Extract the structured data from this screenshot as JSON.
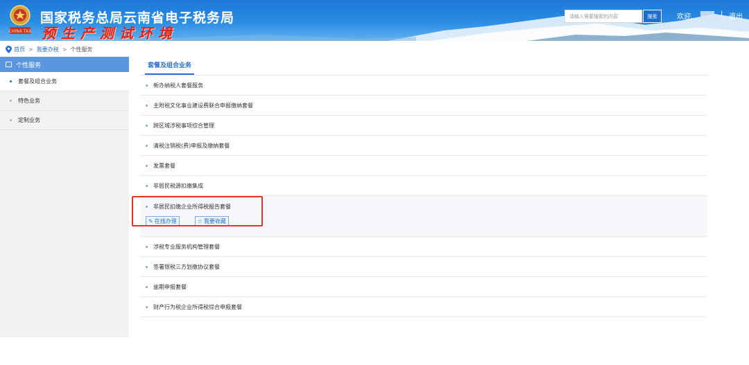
{
  "header": {
    "site_title": "国家税务总局云南省电子税务局",
    "env_banner": "预生产测试环境",
    "search_placeholder": "请输入需要搜索的内容",
    "search_button": "搜索",
    "welcome": "欢迎,",
    "separator": "|",
    "logout": "退出",
    "emblem_text": "CHINA TAX"
  },
  "breadcrumb": {
    "home": "首页",
    "level2": "我要办税",
    "current": "个性服务",
    "sep": ">"
  },
  "sidebar": {
    "title": "个性服务",
    "items": [
      {
        "label": "套餐及组合业务",
        "active": true
      },
      {
        "label": "特色业务",
        "active": false
      },
      {
        "label": "定制业务",
        "active": false
      }
    ]
  },
  "main": {
    "tab_label": "套餐及组合业务",
    "rows": [
      "新办纳税人套餐服务",
      "主附税文化事业建设费联合申报缴纳套餐",
      "跨区域涉税事项综合管理",
      "清税注销税(费)申报及缴纳套餐",
      "发票套餐",
      "非居民税源扣缴集成",
      "非居民扣缴企业所得税报告套餐",
      "涉税专业服务机构管理套餐",
      "签署银税三方划缴协议套餐",
      "逾期申报套餐",
      "财产行为税企业所得税综合申报套餐"
    ],
    "expanded_index": 6,
    "actions": {
      "online": "在线办理",
      "favorite": "我要收藏"
    }
  },
  "colors": {
    "header_blue": "#2b8de4",
    "sidebar_active": "#5a97e0",
    "link_blue": "#2a6fcf",
    "highlight_red": "#e63329",
    "env_red": "#e0211f"
  }
}
